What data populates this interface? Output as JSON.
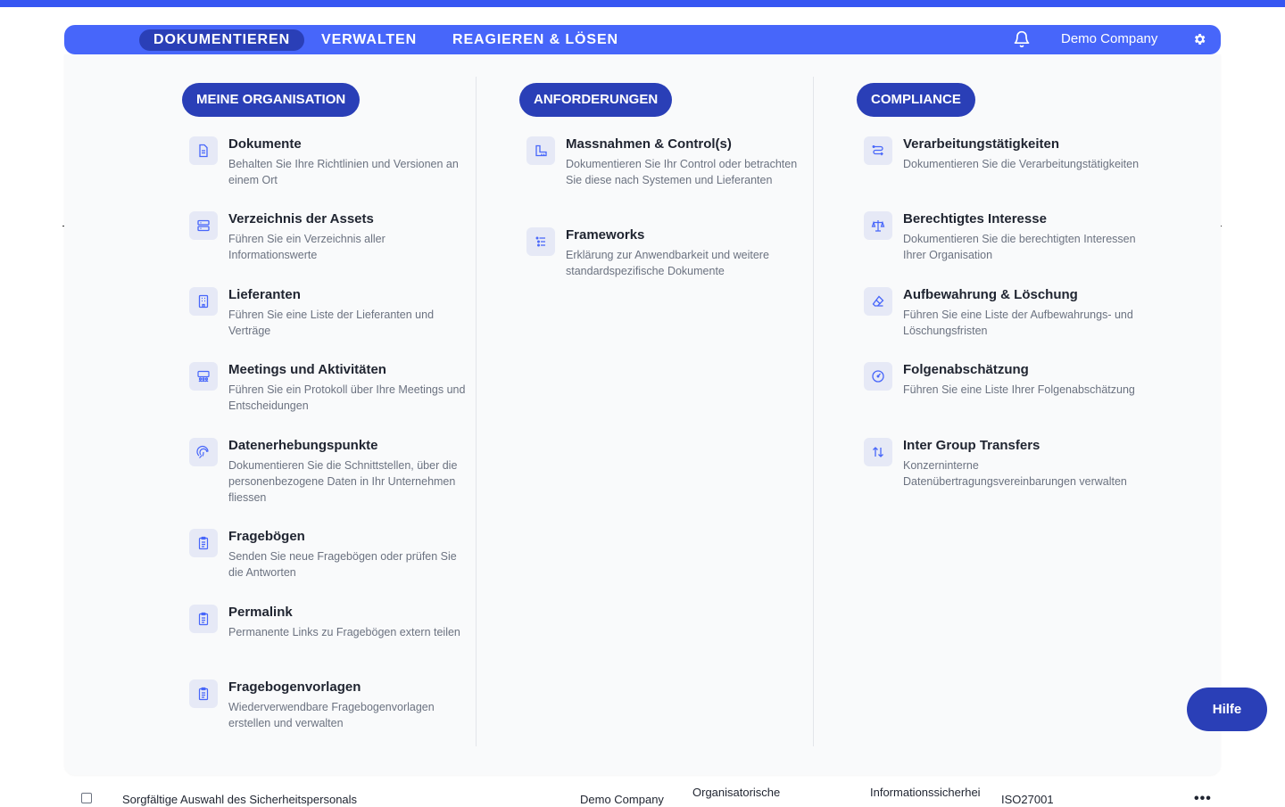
{
  "nav": {
    "tabs": [
      {
        "label": "DOKUMENTIEREN"
      },
      {
        "label": "VERWALTEN"
      },
      {
        "label": "REAGIEREN & LÖSEN"
      }
    ],
    "company": "Demo Company"
  },
  "colors": {
    "primary": "#4766fa",
    "primary_dark": "#2a3fb7",
    "strip": "#3656f2",
    "icon_bg": "#e6e9f6"
  },
  "menu": {
    "columns": [
      {
        "heading": "MEINE ORGANISATION",
        "items": [
          {
            "icon": "document-icon",
            "title": "Dokumente",
            "desc": "Behalten Sie Ihre Richtlinien und Versionen an einem Ort"
          },
          {
            "icon": "server-icon",
            "title": "Verzeichnis der Assets",
            "desc": "Führen Sie ein Verzeichnis aller Informationswerte"
          },
          {
            "icon": "building-icon",
            "title": "Lieferanten",
            "desc": "Führen Sie eine Liste der Lieferanten und Verträge"
          },
          {
            "icon": "meeting-icon",
            "title": "Meetings und Aktivitäten",
            "desc": "Führen Sie ein Protokoll über Ihre Meetings und Entscheidungen"
          },
          {
            "icon": "fingerprint-icon",
            "title": "Datenerhebungspunkte",
            "desc": "Dokumentieren Sie die Schnittstellen, über die personenbezogene Daten in Ihr Unternehmen fliessen"
          },
          {
            "icon": "clipboard-icon",
            "title": "Fragebögen",
            "desc": "Senden Sie neue Fragebögen oder prüfen Sie die Antworten"
          },
          {
            "icon": "clipboard-icon",
            "title": "Permalink",
            "desc": "Permanente Links zu Fragebögen extern teilen"
          },
          {
            "icon": "clipboard-icon",
            "title": "Fragebogenvorlagen",
            "desc": "Wiederverwendbare Fragebogenvorlagen erstellen und verwalten"
          }
        ]
      },
      {
        "heading": "ANFORDERUNGEN",
        "items": [
          {
            "icon": "ruler-icon",
            "title": "Massnahmen & Control(s)",
            "desc": "Dokumentieren Sie Ihr Control oder betrachten Sie diese nach Systemen und Lieferanten"
          },
          {
            "icon": "list-icon",
            "title": "Frameworks",
            "desc": "Erklärung zur Anwendbarkeit und weitere standardspezifische Dokumente"
          }
        ]
      },
      {
        "heading": "COMPLIANCE",
        "items": [
          {
            "icon": "route-icon",
            "title": "Verarbeitungstätigkeiten",
            "desc": "Dokumentieren Sie die Verarbeitungstätigkeiten"
          },
          {
            "icon": "scale-icon",
            "title": "Berechtigtes Interesse",
            "desc": "Dokumentieren Sie die berechtigten Interessen Ihrer Organisation"
          },
          {
            "icon": "eraser-icon",
            "title": "Aufbewahrung & Löschung",
            "desc": "Führen Sie eine Liste der Aufbewahrungs- und Löschungsfristen"
          },
          {
            "icon": "gauge-icon",
            "title": "Folgenabschätzung",
            "desc": "Führen Sie eine Liste Ihrer Folgenabschätzung"
          },
          {
            "icon": "transfer-icon",
            "title": "Inter Group Transfers",
            "desc": "Konzerninterne Datenübertragungsvereinbarungen verwalten"
          }
        ]
      }
    ]
  },
  "help_label": "Hilfe",
  "table_row": {
    "name": "Sorgfältige Auswahl des Sicherheitspersonals",
    "company": "Demo Company",
    "category": "Organisatorische",
    "domain": "Informationssicherhei",
    "framework": "ISO27001",
    "more": "•••"
  }
}
